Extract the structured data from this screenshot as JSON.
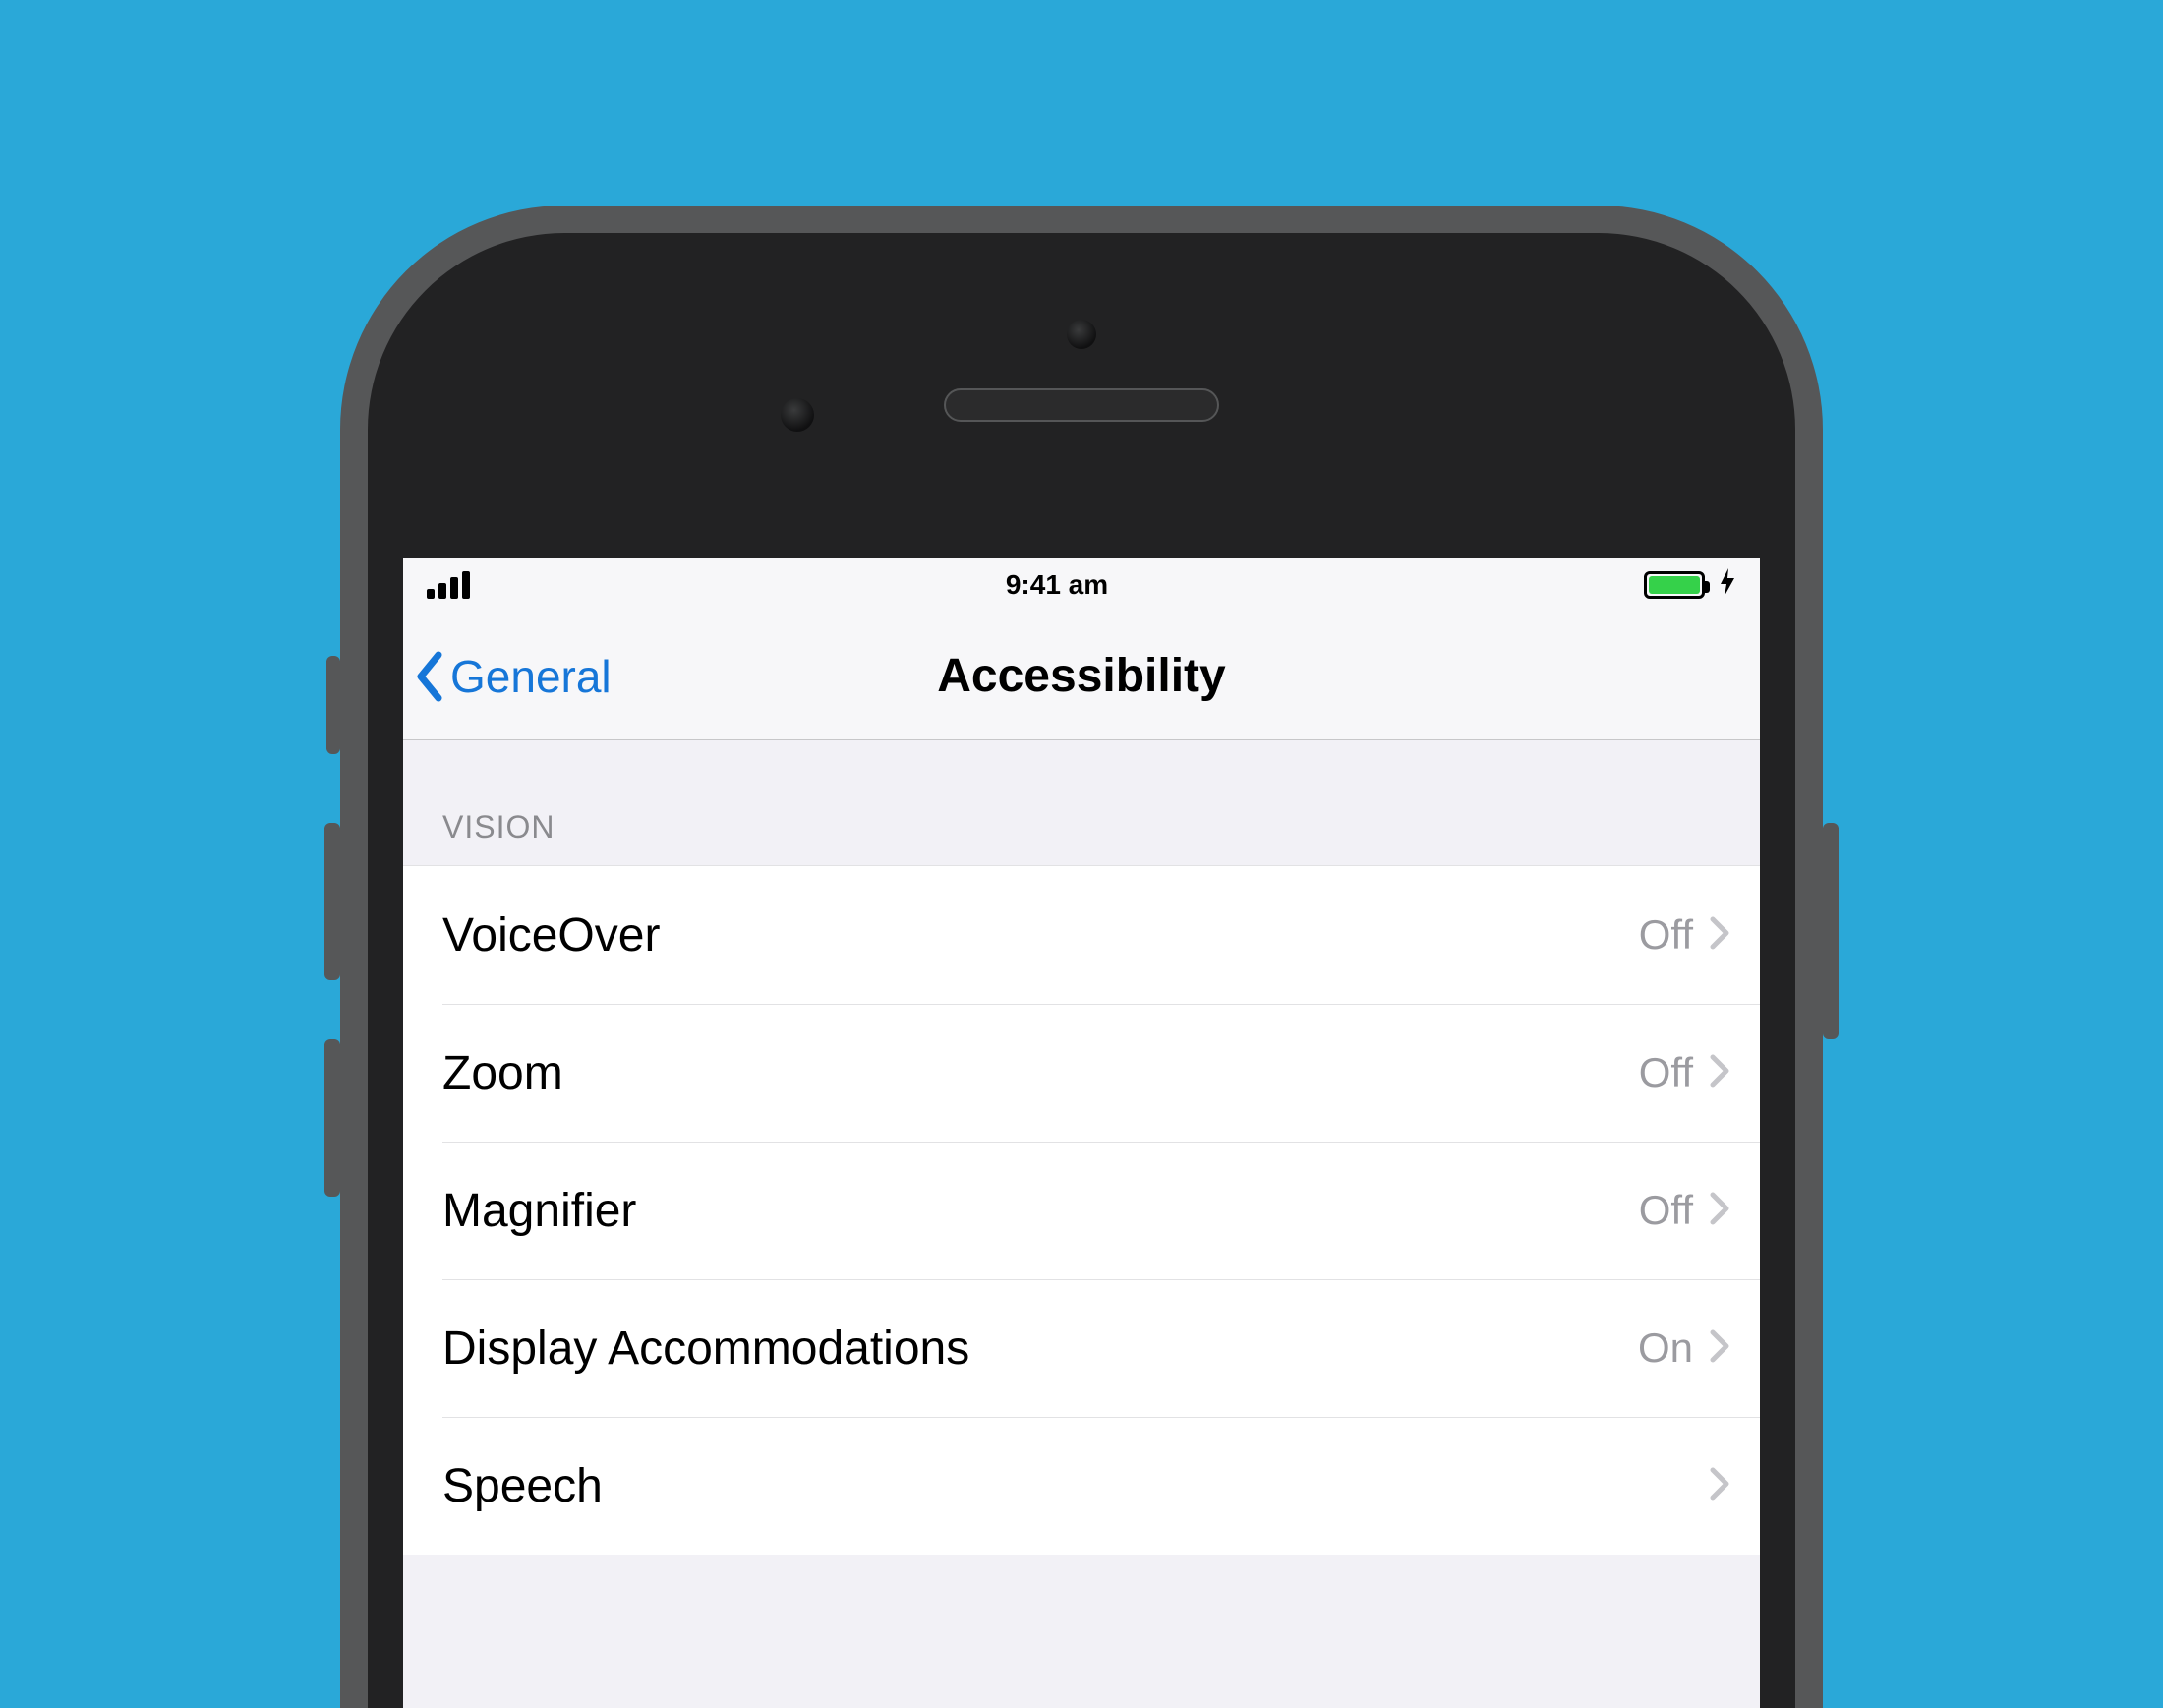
{
  "statusbar": {
    "time": "9:41 am"
  },
  "nav": {
    "back_label": "General",
    "title": "Accessibility"
  },
  "section": {
    "header": "VISION",
    "rows": [
      {
        "label": "VoiceOver",
        "value": "Off"
      },
      {
        "label": "Zoom",
        "value": "Off"
      },
      {
        "label": "Magnifier",
        "value": "Off"
      },
      {
        "label": "Display Accommodations",
        "value": "On"
      },
      {
        "label": "Speech",
        "value": ""
      }
    ]
  }
}
